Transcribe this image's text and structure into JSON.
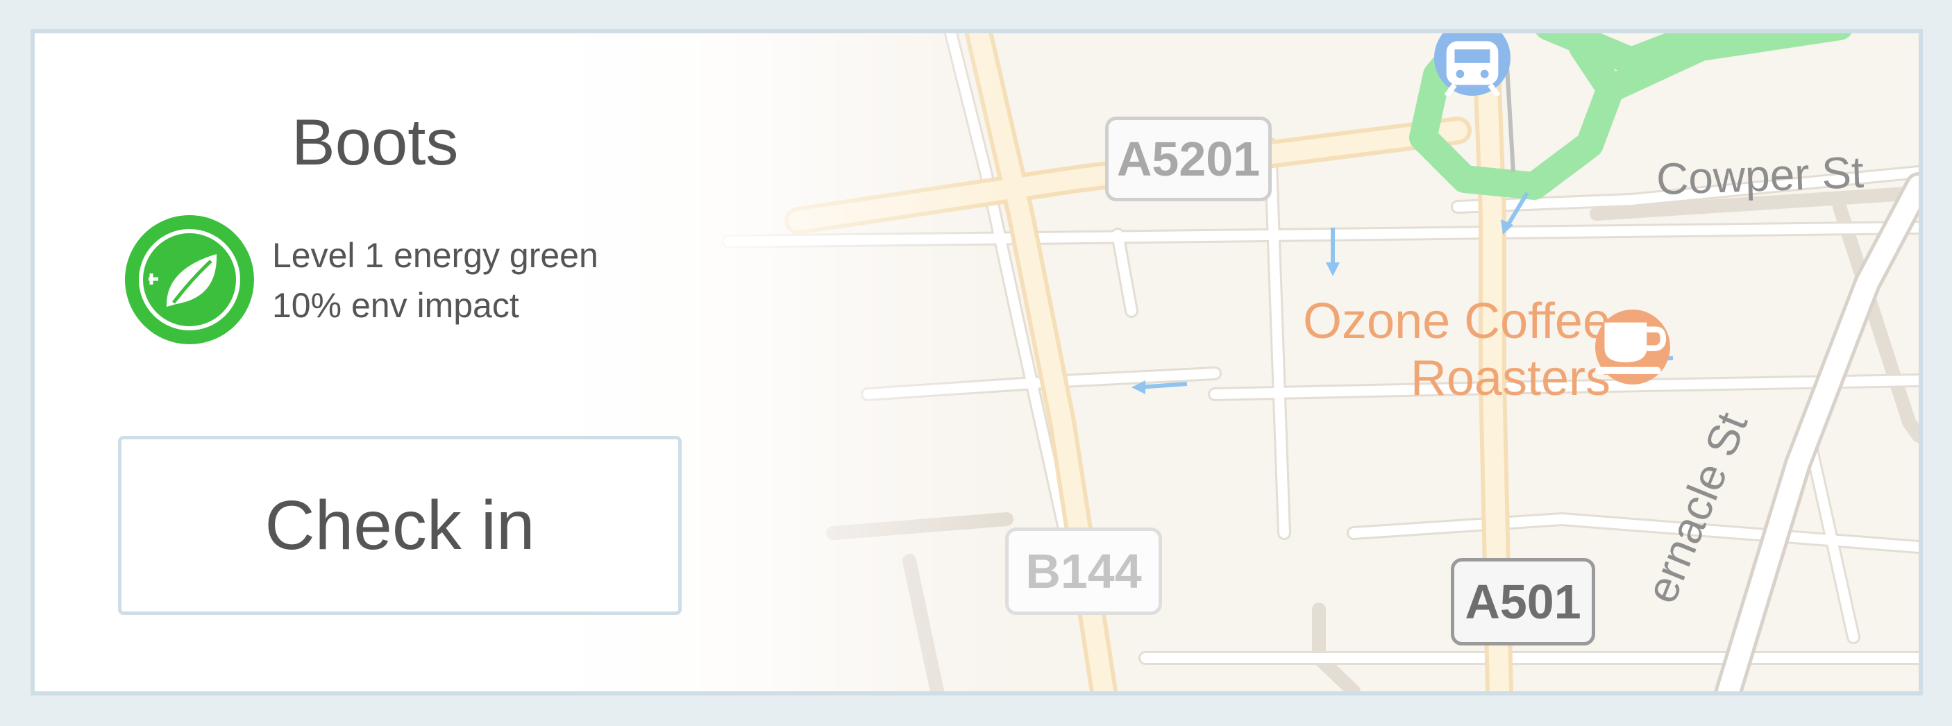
{
  "store": {
    "name": "Boots",
    "energy_level": "Level 1 energy green",
    "env_impact": "10% env impact"
  },
  "actions": {
    "checkin_label": "Check in"
  },
  "map": {
    "road_labels": [
      "A5201",
      "B144",
      "A501"
    ],
    "street_labels": [
      "Cowper St",
      "ernacle St"
    ],
    "poi": {
      "name_line1": "Ozone Coffee",
      "name_line2": "Roasters",
      "icon": "coffee-cup-icon"
    },
    "transit_icon": "train-station-icon"
  },
  "colors": {
    "energy_green": "#3cbf3c",
    "border": "#cfdde6",
    "text": "#555555",
    "poi_orange": "#f0a674",
    "park_green": "#9ee6a6"
  }
}
